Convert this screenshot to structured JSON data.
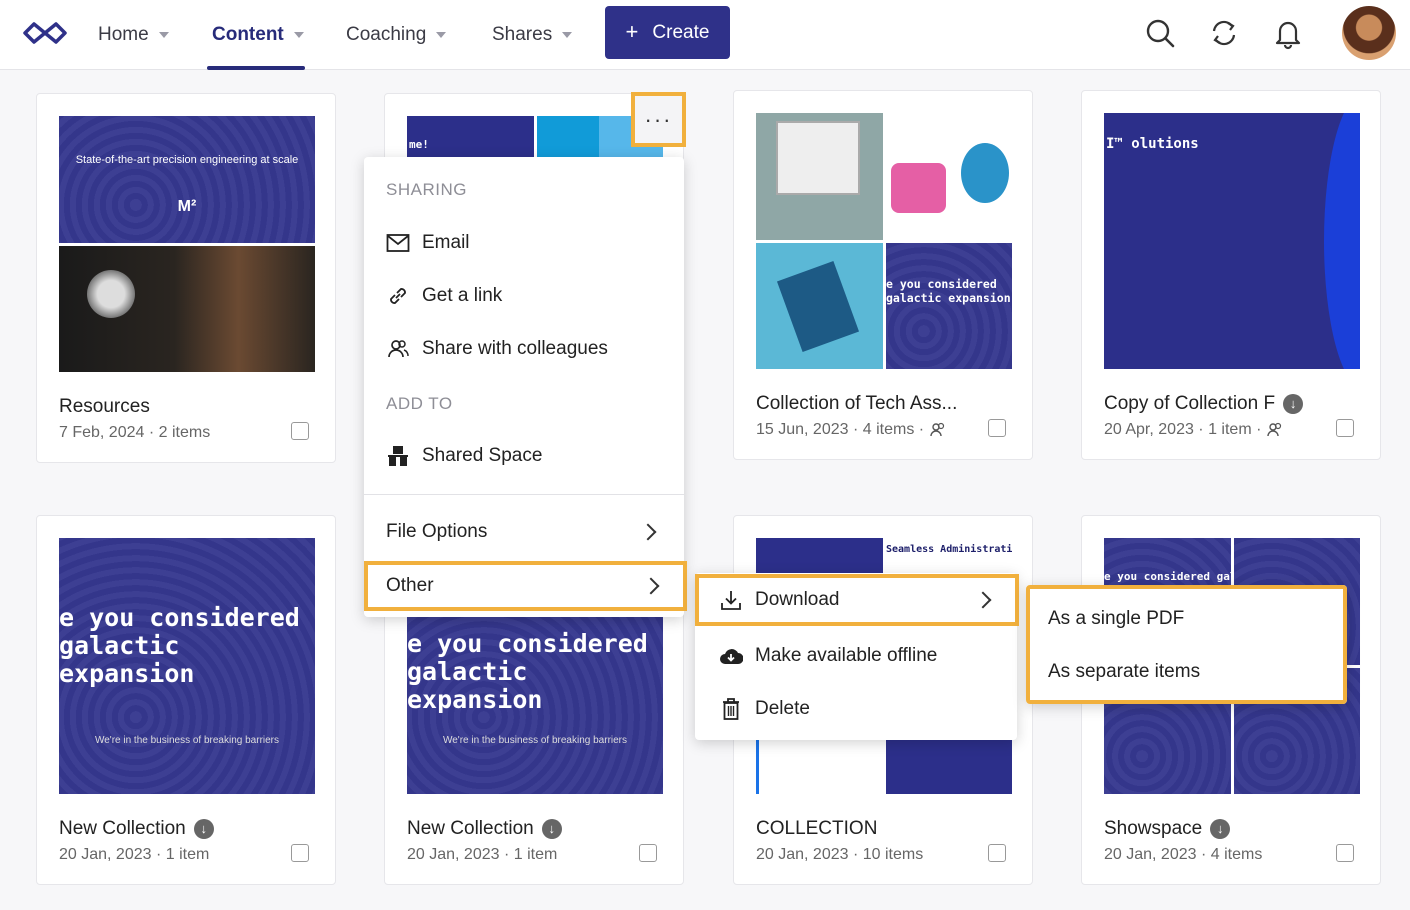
{
  "nav": {
    "items": [
      {
        "label": "Home"
      },
      {
        "label": "Content"
      },
      {
        "label": "Coaching"
      },
      {
        "label": "Shares"
      }
    ],
    "create_label": "Create"
  },
  "cards": [
    {
      "title": "Resources",
      "date": "7 Feb, 2024",
      "count": "2 items",
      "thumb_text": "State-of-the-art precision engineering at scale",
      "thumb_sub": "M²"
    },
    {
      "title": "",
      "date": "",
      "count": "",
      "thumb_text": "me!"
    },
    {
      "title": "Collection of Tech Ass...",
      "date": "15 Jun, 2023",
      "count": "4 items",
      "thumb_text": "e you considered galactic expansion"
    },
    {
      "title": "Copy of Collection F",
      "date": "20 Apr, 2023",
      "count": "1 item",
      "thumb_text": "I™ olutions"
    },
    {
      "title": "New Collection",
      "date": "20 Jan, 2023",
      "count": "1 item",
      "thumb_text": "e you considered galactic expansion",
      "thumb_sub": "We're in the business of breaking barriers"
    },
    {
      "title": "New Collection",
      "date": "20 Jan, 2023",
      "count": "1 item",
      "thumb_text": "e you considered galactic expansion",
      "thumb_sub": "We're in the business of breaking barriers"
    },
    {
      "title": "COLLECTION",
      "date": "20 Jan, 2023",
      "count": "10 items",
      "thumb_text": "Seamless Administration"
    },
    {
      "title": "Showspace",
      "date": "20 Jan, 2023",
      "count": "4 items",
      "thumb_text": "e you considered galactic expansion"
    }
  ],
  "context_menu": {
    "sharing_header": "SHARING",
    "email": "Email",
    "get_link": "Get a link",
    "share_colleagues": "Share with colleagues",
    "add_to_header": "ADD TO",
    "shared_space": "Shared Space",
    "file_options": "File Options",
    "other": "Other"
  },
  "other_submenu": {
    "download": "Download",
    "offline": "Make available offline",
    "delete": "Delete"
  },
  "download_submenu": {
    "single_pdf": "As a single PDF",
    "separate": "As separate items"
  },
  "colors": {
    "brand": "#2f3189",
    "highlight": "#f1b03d"
  }
}
